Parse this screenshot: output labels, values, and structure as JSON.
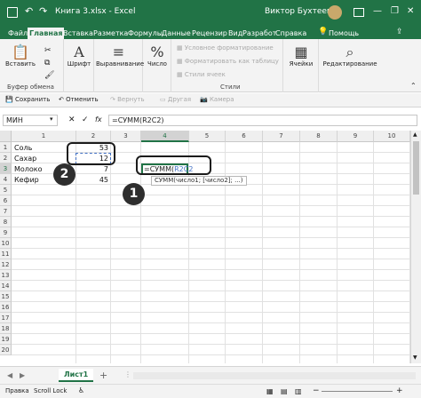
{
  "titlebar": {
    "autosave_label": "",
    "file_title": "Книга 3.xlsx  -  Excel",
    "user_name": "Виктор Бухтеев",
    "minimize": "—",
    "restore": "❐",
    "close": "✕"
  },
  "tabs": [
    "Файл",
    "Главная",
    "Вставка",
    "Разметка",
    "Формулы",
    "Данные",
    "Рецензир",
    "Вид",
    "Разработ",
    "Справка"
  ],
  "tab_active_index": 1,
  "help": {
    "label": "Помощь"
  },
  "ribbon": {
    "paste_label": "Вставить",
    "font_label": "Шрифт",
    "align_label": "Выравнивание",
    "number_label": "Число",
    "cond_format_label": "Условное форматирование",
    "format_table_label": "Форматировать как таблицу",
    "cell_styles_label": "Стили ячеек",
    "styles_group_label": "Стили",
    "cells_label": "Ячейки",
    "editing_label": "Редактирование",
    "clipboard_group_label": "Буфер обмена"
  },
  "qat": {
    "save": "Сохранить",
    "undo": "Отменить",
    "redo": "Вернуть",
    "other": "Другая",
    "camera": "Камера"
  },
  "formula_bar": {
    "name_box": "МИН",
    "formula": "=СУММ(R2C2)",
    "fx": "fx"
  },
  "grid": {
    "columns": [
      "1",
      "2",
      "3",
      "4",
      "5",
      "6",
      "7",
      "8",
      "9",
      "10",
      "11"
    ],
    "rows": [
      "1",
      "2",
      "3",
      "4",
      "5",
      "6",
      "7",
      "8",
      "9",
      "10",
      "11",
      "12",
      "13",
      "14",
      "15",
      "16",
      "17",
      "18",
      "19",
      "20"
    ],
    "selected_column_index": 3,
    "data": [
      {
        "label": "Соль",
        "value": "53"
      },
      {
        "label": "Сахар",
        "value": "12"
      },
      {
        "label": "Молоко",
        "value": "7"
      },
      {
        "label": "Кефир",
        "value": "45"
      }
    ],
    "editing_cell_text_prefix": "=СУММ(",
    "editing_cell_ref": "R2C2",
    "editing_cell_suffix": "",
    "tooltip": "СУММ(число1; [число2]; ...)"
  },
  "badges": {
    "one": "1",
    "two": "2"
  },
  "sheets": {
    "active": "Лист1",
    "add": "+"
  },
  "status": {
    "mode": "Правка",
    "scroll_lock": "Scroll Lock",
    "zoom": "+"
  },
  "colors": {
    "excel_green": "#217346",
    "ref_blue": "#4472c4",
    "callout": "#1c1c1c"
  }
}
